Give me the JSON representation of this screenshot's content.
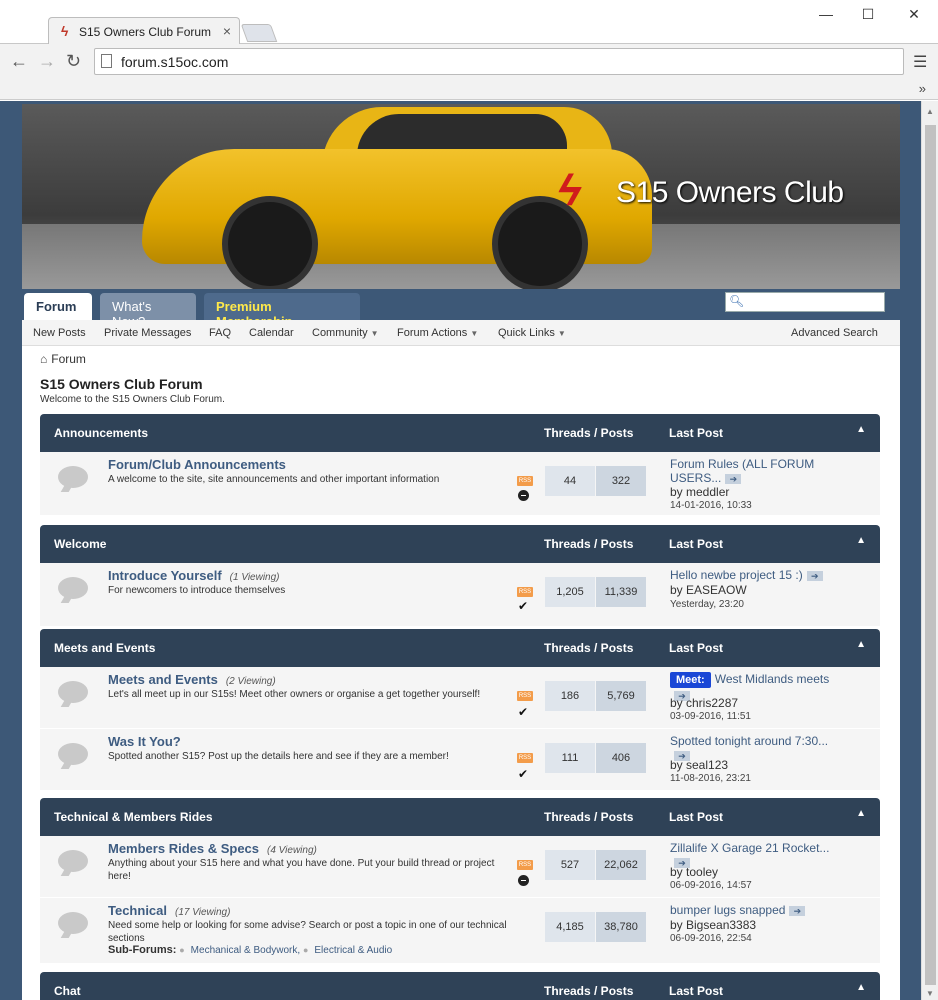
{
  "browser": {
    "tab_title": "S15 Owners Club Forum",
    "tab_close": "×",
    "url": "forum.s15oc.com",
    "more": "»",
    "minimize": "—",
    "maximize": "☐",
    "close": "✕",
    "back": "←",
    "forward": "→",
    "reload": "↻",
    "menu": "☰"
  },
  "banner": {
    "logo_text": "S15 Owners Club"
  },
  "navtabs": [
    {
      "label": "Forum"
    },
    {
      "label": "What's New?"
    },
    {
      "label": "Premium Membership"
    }
  ],
  "subnav": {
    "items": [
      "New Posts",
      "Private Messages",
      "FAQ",
      "Calendar",
      "Community",
      "Forum Actions",
      "Quick Links"
    ],
    "advanced_search": "Advanced Search"
  },
  "breadcrumb": "Forum",
  "forum": {
    "title": "S15 Owners Club Forum",
    "welcome": "Welcome to the S15 Owners Club Forum."
  },
  "column_headers": {
    "threads_posts": "Threads / Posts",
    "last_post": "Last Post"
  },
  "categories": [
    {
      "name": "Announcements",
      "forums": [
        {
          "name": "Forum/Club Announcements",
          "viewing": "",
          "desc": "A welcome to the site, site announcements and other important information",
          "threads": "44",
          "posts": "322",
          "last_title": "Forum Rules (ALL FORUM USERS...",
          "last_by": "by meddler",
          "last_date": "14-01-2016, 10:33",
          "prefix": ""
        }
      ]
    },
    {
      "name": "Welcome",
      "forums": [
        {
          "name": "Introduce Yourself",
          "viewing": "(1 Viewing)",
          "desc": "For newcomers to introduce themselves",
          "threads": "1,205",
          "posts": "11,339",
          "last_title": "Hello newbe project 15 :)",
          "last_by": "by EASEAOW",
          "last_date": "Yesterday, 23:20",
          "prefix": ""
        }
      ]
    },
    {
      "name": "Meets and Events",
      "forums": [
        {
          "name": "Meets and Events",
          "viewing": "(2 Viewing)",
          "desc": "Let's all meet up in our S15s! Meet other owners or organise a get together yourself!",
          "threads": "186",
          "posts": "5,769",
          "last_title": "West Midlands meets",
          "last_by": "by chris2287",
          "last_date": "03-09-2016, 11:51",
          "prefix": "Meet:"
        },
        {
          "name": "Was It You?",
          "viewing": "",
          "desc": "Spotted another S15? Post up the details here and see if they are a member!",
          "threads": "111",
          "posts": "406",
          "last_title": "Spotted tonight around 7:30...",
          "last_by": "by seal123",
          "last_date": "11-08-2016, 23:21",
          "prefix": ""
        }
      ]
    },
    {
      "name": "Technical & Members Rides",
      "forums": [
        {
          "name": "Members Rides & Specs",
          "viewing": "(4 Viewing)",
          "desc": "Anything about your S15 here and what you have done. Put your build thread or project here!",
          "threads": "527",
          "posts": "22,062",
          "last_title": "Zillalife X Garage 21 Rocket...",
          "last_by": "by tooley",
          "last_date": "06-09-2016, 14:57",
          "prefix": ""
        },
        {
          "name": "Technical",
          "viewing": "(17 Viewing)",
          "desc": "Need some help or looking for some advise? Search or post a topic in one of our technical sections",
          "threads": "4,185",
          "posts": "38,780",
          "last_title": "bumper lugs snapped",
          "last_by": "by Bigsean3383",
          "last_date": "06-09-2016, 22:54",
          "prefix": "",
          "subforums_label": "Sub-Forums:",
          "subforums": [
            "Mechanical & Bodywork,",
            "Electrical & Audio"
          ]
        }
      ]
    },
    {
      "name": "Chat",
      "forums": []
    }
  ],
  "icons": {
    "rss": "RSS"
  }
}
